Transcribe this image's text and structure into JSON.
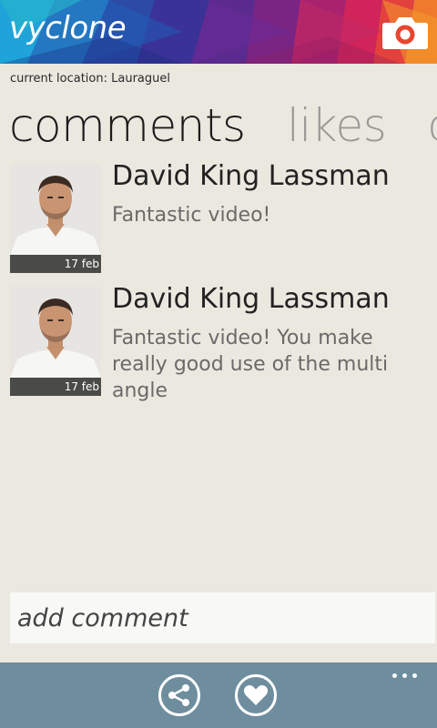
{
  "app": {
    "logo_text": "vyclone",
    "brand_colors": [
      "#1a8fd0",
      "#2c3a9a",
      "#7a2a8a",
      "#d2245a",
      "#e8503a",
      "#f5a623"
    ]
  },
  "header": {
    "camera_icon": "camera-icon"
  },
  "location": {
    "text": "current location: Lauraguel"
  },
  "tabs": [
    {
      "label": "comments",
      "active": true
    },
    {
      "label": "likes",
      "active": false
    },
    {
      "label": "contributors",
      "active": false
    }
  ],
  "comments": [
    {
      "author": "David King Lassman",
      "date": "17 feb",
      "text": "Fantastic video!"
    },
    {
      "author": "David King Lassman",
      "date": "17 feb",
      "text": "Fantastic video! You make really good use of the multi angle"
    }
  ],
  "input": {
    "placeholder": "add comment",
    "value": ""
  },
  "appbar": {
    "background": "#6e8e9e",
    "buttons": [
      {
        "icon": "share-icon"
      },
      {
        "icon": "heart-icon"
      }
    ],
    "more_icon": "more-dots-icon"
  }
}
